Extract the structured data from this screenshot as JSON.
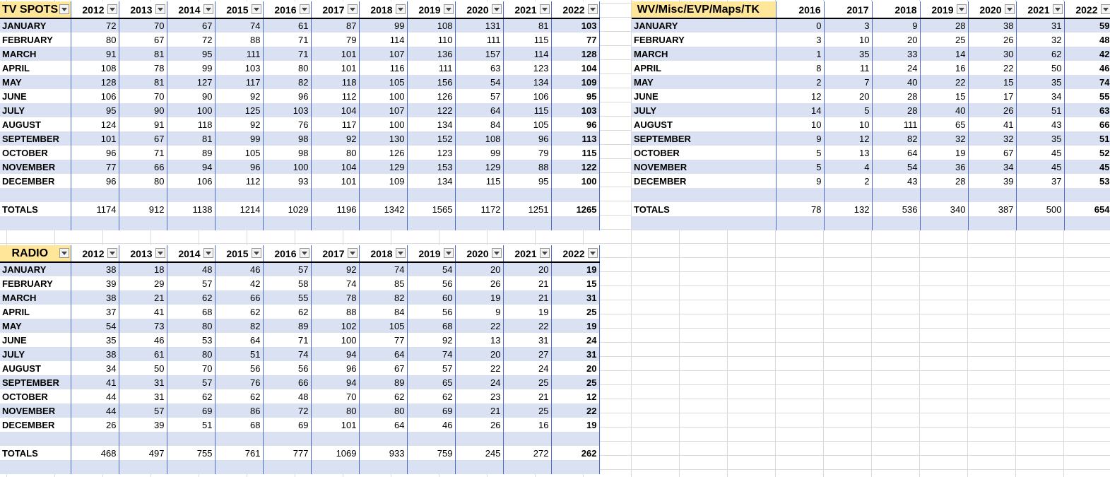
{
  "tv": {
    "title": "TV SPOTS",
    "years": [
      "2012",
      "2013",
      "2014",
      "2015",
      "2016",
      "2017",
      "2018",
      "2019",
      "2020",
      "2021",
      "2022"
    ],
    "rows": [
      {
        "month": "JANUARY",
        "values": [
          "72",
          "70",
          "67",
          "74",
          "61",
          "87",
          "99",
          "108",
          "131",
          "81",
          "103"
        ]
      },
      {
        "month": "FEBRUARY",
        "values": [
          "80",
          "67",
          "72",
          "88",
          "71",
          "79",
          "114",
          "110",
          "111",
          "115",
          "77"
        ]
      },
      {
        "month": "MARCH",
        "values": [
          "91",
          "81",
          "95",
          "111",
          "71",
          "101",
          "107",
          "136",
          "157",
          "114",
          "128"
        ]
      },
      {
        "month": "APRIL",
        "values": [
          "108",
          "78",
          "99",
          "103",
          "80",
          "101",
          "116",
          "111",
          "63",
          "123",
          "104"
        ]
      },
      {
        "month": "MAY",
        "values": [
          "128",
          "81",
          "127",
          "117",
          "82",
          "118",
          "105",
          "156",
          "54",
          "134",
          "109"
        ]
      },
      {
        "month": "JUNE",
        "values": [
          "106",
          "70",
          "90",
          "92",
          "96",
          "112",
          "100",
          "126",
          "57",
          "106",
          "95"
        ]
      },
      {
        "month": "JULY",
        "values": [
          "95",
          "90",
          "100",
          "125",
          "103",
          "104",
          "107",
          "122",
          "64",
          "115",
          "103"
        ]
      },
      {
        "month": "AUGUST",
        "values": [
          "124",
          "91",
          "118",
          "92",
          "76",
          "117",
          "100",
          "134",
          "84",
          "105",
          "96"
        ]
      },
      {
        "month": "SEPTEMBER",
        "values": [
          "101",
          "67",
          "81",
          "99",
          "98",
          "92",
          "130",
          "152",
          "108",
          "96",
          "113"
        ]
      },
      {
        "month": "OCTOBER",
        "values": [
          "96",
          "71",
          "89",
          "105",
          "98",
          "80",
          "126",
          "123",
          "99",
          "79",
          "115"
        ]
      },
      {
        "month": "NOVEMBER",
        "values": [
          "77",
          "66",
          "94",
          "96",
          "100",
          "104",
          "129",
          "153",
          "129",
          "88",
          "122"
        ]
      },
      {
        "month": "DECEMBER",
        "values": [
          "96",
          "80",
          "106",
          "112",
          "93",
          "101",
          "109",
          "134",
          "115",
          "95",
          "100"
        ]
      }
    ],
    "totals_label": "TOTALS",
    "totals": [
      "1174",
      "912",
      "1138",
      "1214",
      "1029",
      "1196",
      "1342",
      "1565",
      "1172",
      "1251",
      "1265"
    ]
  },
  "wv": {
    "title": "WV/Misc/EVP/Maps/TK",
    "years": [
      "2016",
      "2017",
      "2018",
      "2019",
      "2020",
      "2021",
      "2022"
    ],
    "filters": [
      false,
      false,
      false,
      true,
      true,
      true,
      true
    ],
    "rows": [
      {
        "month": "JANUARY",
        "values": [
          "0",
          "3",
          "9",
          "28",
          "38",
          "31",
          "59"
        ]
      },
      {
        "month": "FEBRUARY",
        "values": [
          "3",
          "10",
          "20",
          "25",
          "26",
          "32",
          "48"
        ]
      },
      {
        "month": "MARCH",
        "values": [
          "1",
          "35",
          "33",
          "14",
          "30",
          "62",
          "42"
        ]
      },
      {
        "month": "APRIL",
        "values": [
          "8",
          "11",
          "24",
          "16",
          "22",
          "50",
          "46"
        ]
      },
      {
        "month": "MAY",
        "values": [
          "2",
          "7",
          "40",
          "22",
          "15",
          "35",
          "74"
        ]
      },
      {
        "month": "JUNE",
        "values": [
          "12",
          "20",
          "28",
          "15",
          "17",
          "34",
          "55"
        ]
      },
      {
        "month": "JULY",
        "values": [
          "14",
          "5",
          "28",
          "40",
          "26",
          "51",
          "63"
        ]
      },
      {
        "month": "AUGUST",
        "values": [
          "10",
          "10",
          "111",
          "65",
          "41",
          "43",
          "66"
        ]
      },
      {
        "month": "SEPTEMBER",
        "values": [
          "9",
          "12",
          "82",
          "32",
          "32",
          "35",
          "51"
        ]
      },
      {
        "month": "OCTOBER",
        "values": [
          "5",
          "13",
          "64",
          "19",
          "67",
          "45",
          "52"
        ]
      },
      {
        "month": "NOVEMBER",
        "values": [
          "5",
          "4",
          "54",
          "36",
          "34",
          "45",
          "45"
        ]
      },
      {
        "month": "DECEMBER",
        "values": [
          "9",
          "2",
          "43",
          "28",
          "39",
          "37",
          "53"
        ]
      }
    ],
    "totals_label": "TOTALS",
    "totals": [
      "78",
      "132",
      "536",
      "340",
      "387",
      "500",
      "654"
    ]
  },
  "radio": {
    "title": "RADIO",
    "years": [
      "2012",
      "2013",
      "2014",
      "2015",
      "2016",
      "2017",
      "2018",
      "2019",
      "2020",
      "2021",
      "2022"
    ],
    "rows": [
      {
        "month": "JANUARY",
        "values": [
          "38",
          "18",
          "48",
          "46",
          "57",
          "92",
          "74",
          "54",
          "20",
          "20",
          "19"
        ]
      },
      {
        "month": "FEBRUARY",
        "values": [
          "39",
          "29",
          "57",
          "42",
          "58",
          "74",
          "85",
          "56",
          "26",
          "21",
          "15"
        ]
      },
      {
        "month": "MARCH",
        "values": [
          "38",
          "21",
          "62",
          "66",
          "55",
          "78",
          "82",
          "60",
          "19",
          "21",
          "31"
        ]
      },
      {
        "month": "APRIL",
        "values": [
          "37",
          "41",
          "68",
          "62",
          "62",
          "88",
          "84",
          "56",
          "9",
          "19",
          "25"
        ]
      },
      {
        "month": "MAY",
        "values": [
          "54",
          "73",
          "80",
          "82",
          "89",
          "102",
          "105",
          "68",
          "22",
          "22",
          "19"
        ]
      },
      {
        "month": "JUNE",
        "values": [
          "35",
          "46",
          "53",
          "64",
          "71",
          "100",
          "77",
          "92",
          "13",
          "31",
          "24"
        ]
      },
      {
        "month": "JULY",
        "values": [
          "38",
          "61",
          "80",
          "51",
          "74",
          "94",
          "64",
          "74",
          "20",
          "27",
          "31"
        ]
      },
      {
        "month": "AUGUST",
        "values": [
          "34",
          "50",
          "70",
          "56",
          "56",
          "96",
          "67",
          "57",
          "22",
          "24",
          "20"
        ]
      },
      {
        "month": "SEPTEMBER",
        "values": [
          "41",
          "31",
          "57",
          "76",
          "66",
          "94",
          "89",
          "65",
          "24",
          "25",
          "25"
        ]
      },
      {
        "month": "OCTOBER",
        "values": [
          "44",
          "31",
          "62",
          "62",
          "48",
          "70",
          "62",
          "62",
          "23",
          "21",
          "12"
        ]
      },
      {
        "month": "NOVEMBER",
        "values": [
          "44",
          "57",
          "69",
          "86",
          "72",
          "80",
          "80",
          "69",
          "21",
          "25",
          "22"
        ]
      },
      {
        "month": "DECEMBER",
        "values": [
          "26",
          "39",
          "51",
          "68",
          "69",
          "101",
          "64",
          "46",
          "26",
          "16",
          "19"
        ]
      }
    ],
    "totals_label": "TOTALS",
    "totals": [
      "468",
      "497",
      "755",
      "761",
      "777",
      "1069",
      "933",
      "759",
      "245",
      "272",
      "262"
    ]
  }
}
